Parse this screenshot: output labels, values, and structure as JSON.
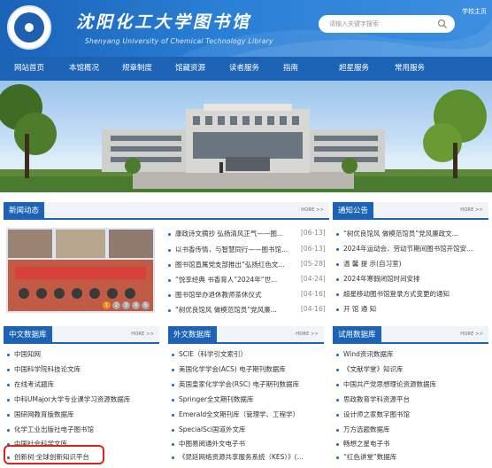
{
  "header": {
    "title": "沈阳化工大学图书馆",
    "subtitle": "Shenyang University of Chemical Technology Library",
    "search_placeholder": "请输入关键字搜索",
    "home_link": "学校主页"
  },
  "nav": {
    "items": [
      "网站首页",
      "本馆概况",
      "规章制度",
      "馆藏资源",
      "读者服务",
      "指南",
      "超星服务",
      "常用服务"
    ]
  },
  "news": {
    "title": "新闻动态",
    "more": "HORE >>",
    "items": [
      {
        "text": "康政诗文摘抄 弘扬清风正气——图...",
        "date": "[06-13]"
      },
      {
        "text": "以书香传情，与智慧同行——图书馆...",
        "date": "[06-13]"
      },
      {
        "text": "图书馆直属党支部推出“弘扬红色文...",
        "date": "[05-28]"
      },
      {
        "text": "“悦享经典 书香育人”2024年“世...",
        "date": "[04-24]"
      },
      {
        "text": "图书馆举办退休教师茶休仪式",
        "date": "[04-16]"
      },
      {
        "text": "“树优良馆风 做模范馆员”党风廉...",
        "date": "[04-16]"
      }
    ],
    "pager": [
      "1",
      "2",
      "3",
      "4",
      "5"
    ]
  },
  "notice": {
    "title": "通知公告",
    "more": "HORE >>",
    "items": [
      "“树优良馆风 做模范馆员”党风廉政文...",
      "2024年运动会、劳动节期间图书馆开馆安...",
      "温 馨 提 示(自习室)",
      "2024年寒假闭馆时间安排",
      "超星移动图书馆登录方式变更的通知",
      "开 馆 通 知"
    ]
  },
  "cn_db": {
    "title": "中文数据库",
    "more": "HORE >>",
    "items": [
      "中国知网",
      "中国科学院科技论文库",
      "在线考试题库",
      "中科UMajor大学专业课学习资源数据库",
      "国研网教育版数据库",
      "化学工业出版社电子图书馆",
      "中国社会科学文库",
      "创新树·全球创新知识平台"
    ]
  },
  "en_db": {
    "title": "外文数据库",
    "more": "HORE >>",
    "items": [
      "SCIE（科学引文索引）",
      "美国化学学会(ACS) 电子期刊数据库",
      "英国皇家化学学会(RSC) 电子期刊数据库",
      "Springer全文期刊数据库",
      "Emerald全文期刊库（管理学、工程学）",
      "SpecialSci国道外文库",
      "中图易阅通外文电子书",
      "《昆廷网络资源共享服务系统（KES）》(..."
    ]
  },
  "trial_db": {
    "title": "试用数据库",
    "more": "HORE >>",
    "items": [
      "Wind资讯数据库",
      "《文献学堂》知识库",
      "中国共产党思想理论资源数据库",
      "思政教育学科资源平台",
      "设计师之家数字图书馆",
      "万方选题数据库",
      "畅想之星电子书",
      "“红色讲堂”数据库"
    ]
  },
  "colors": {
    "primary": "#1d63b5",
    "highlight": "#e0201b",
    "pager_active": "#f08a1c"
  }
}
